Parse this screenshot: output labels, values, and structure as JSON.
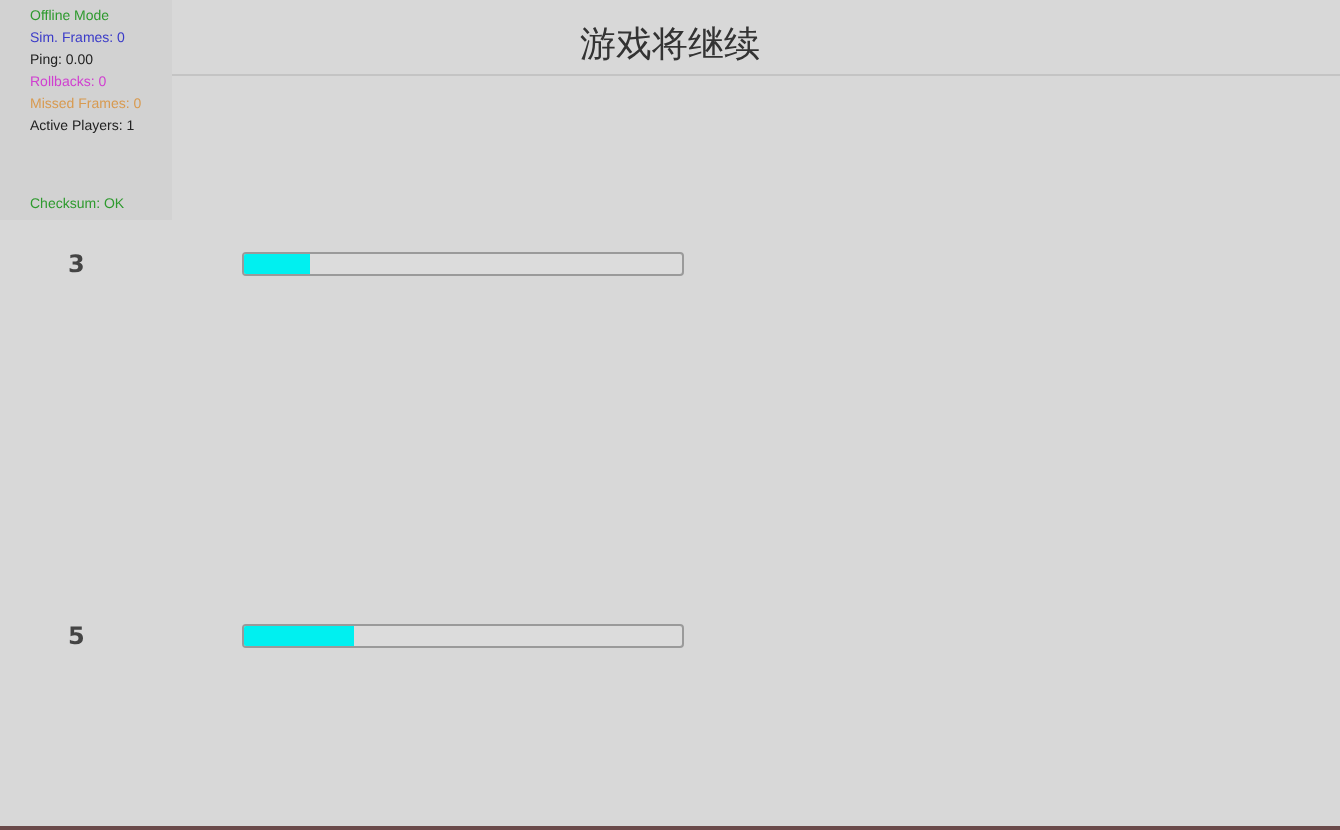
{
  "title": "游戏将继续",
  "debug_panel": {
    "lines": [
      {
        "text": "Offline Mode",
        "color": "#2e9a2e"
      },
      {
        "text": "Sim. Frames: 0",
        "color": "#3a3ac8"
      },
      {
        "text": "Ping: 0.00",
        "color": "#222222"
      },
      {
        "text": "Rollbacks: 0",
        "color": "#d040d0"
      },
      {
        "text": "Missed Frames: 0",
        "color": "#d89a50"
      },
      {
        "text": "Active Players: 1",
        "color": "#222222"
      }
    ],
    "checksum": {
      "text": "Checksum: OK",
      "color": "#2e9a2e"
    }
  },
  "players": [
    {
      "number": "3",
      "level": 0.15
    },
    {
      "number": "5",
      "level": 0.25
    }
  ]
}
